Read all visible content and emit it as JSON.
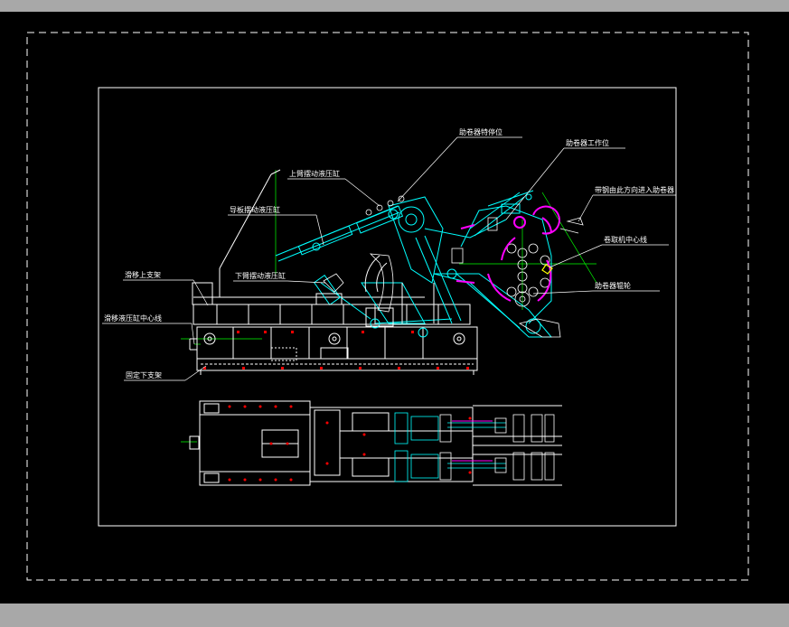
{
  "colors": {
    "background": "#000000",
    "chrome": "#a8a8a8",
    "linework": "#ffffff",
    "mechanism": "#00ffff",
    "accent": "#ff00ff",
    "centerlines": "#00ff00",
    "markers": "#ff0000",
    "highlight": "#ffff00"
  },
  "labels": {
    "upper_swing_cylinder": "上臂摆动液压缸",
    "assist_roll_limit": "助卷器特停位",
    "assist_roll_working": "助卷器工作位",
    "guide_pivot_cylinder": "导板摆动液压缸",
    "strip_entry": "带钢由此方向进入助卷器",
    "coiler_center": "卷取机中心线",
    "lower_swing_cylinder": "下臂摆动液压缸",
    "assist_roll": "助卷器辊轮",
    "movable_upper_frame": "滑移上支架",
    "slide_cylinder_center": "滑移液压缸中心线",
    "fixed_lower_frame": "固定下支架"
  }
}
